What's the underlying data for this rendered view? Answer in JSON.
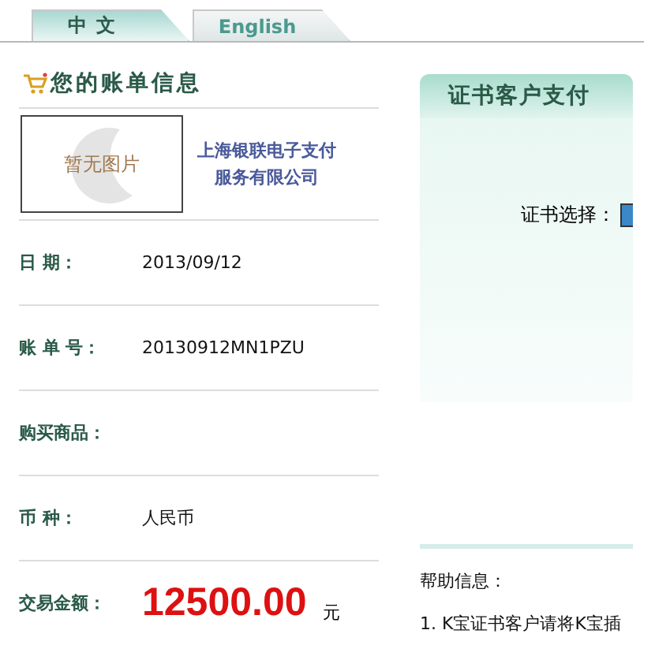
{
  "tabs": [
    {
      "label": "中文",
      "selected": true
    },
    {
      "label": "English",
      "selected": false
    }
  ],
  "bill": {
    "title": "您的账单信息",
    "no_image_text": "暂无图片",
    "merchant": "上海银联电子支付服务有限公司",
    "rows": [
      {
        "label": "日 期：",
        "value": "2013/09/12",
        "kind": "text"
      },
      {
        "label": "账 单 号：",
        "value": "20130912MN1PZU",
        "kind": "text"
      },
      {
        "label": "购买商品：",
        "kind": "text"
      },
      {
        "label": "币 种：",
        "value": "人民币",
        "kind": "text"
      },
      {
        "label": "交易金额：",
        "value": "12500.00",
        "unit": "元",
        "kind": "amount"
      }
    ]
  },
  "cert_panel": {
    "title": "证书客户支付",
    "select_label": "证书选择："
  },
  "help": {
    "title": "帮助信息：",
    "items": [
      "1. K宝证书客户请将K宝插"
    ]
  }
}
